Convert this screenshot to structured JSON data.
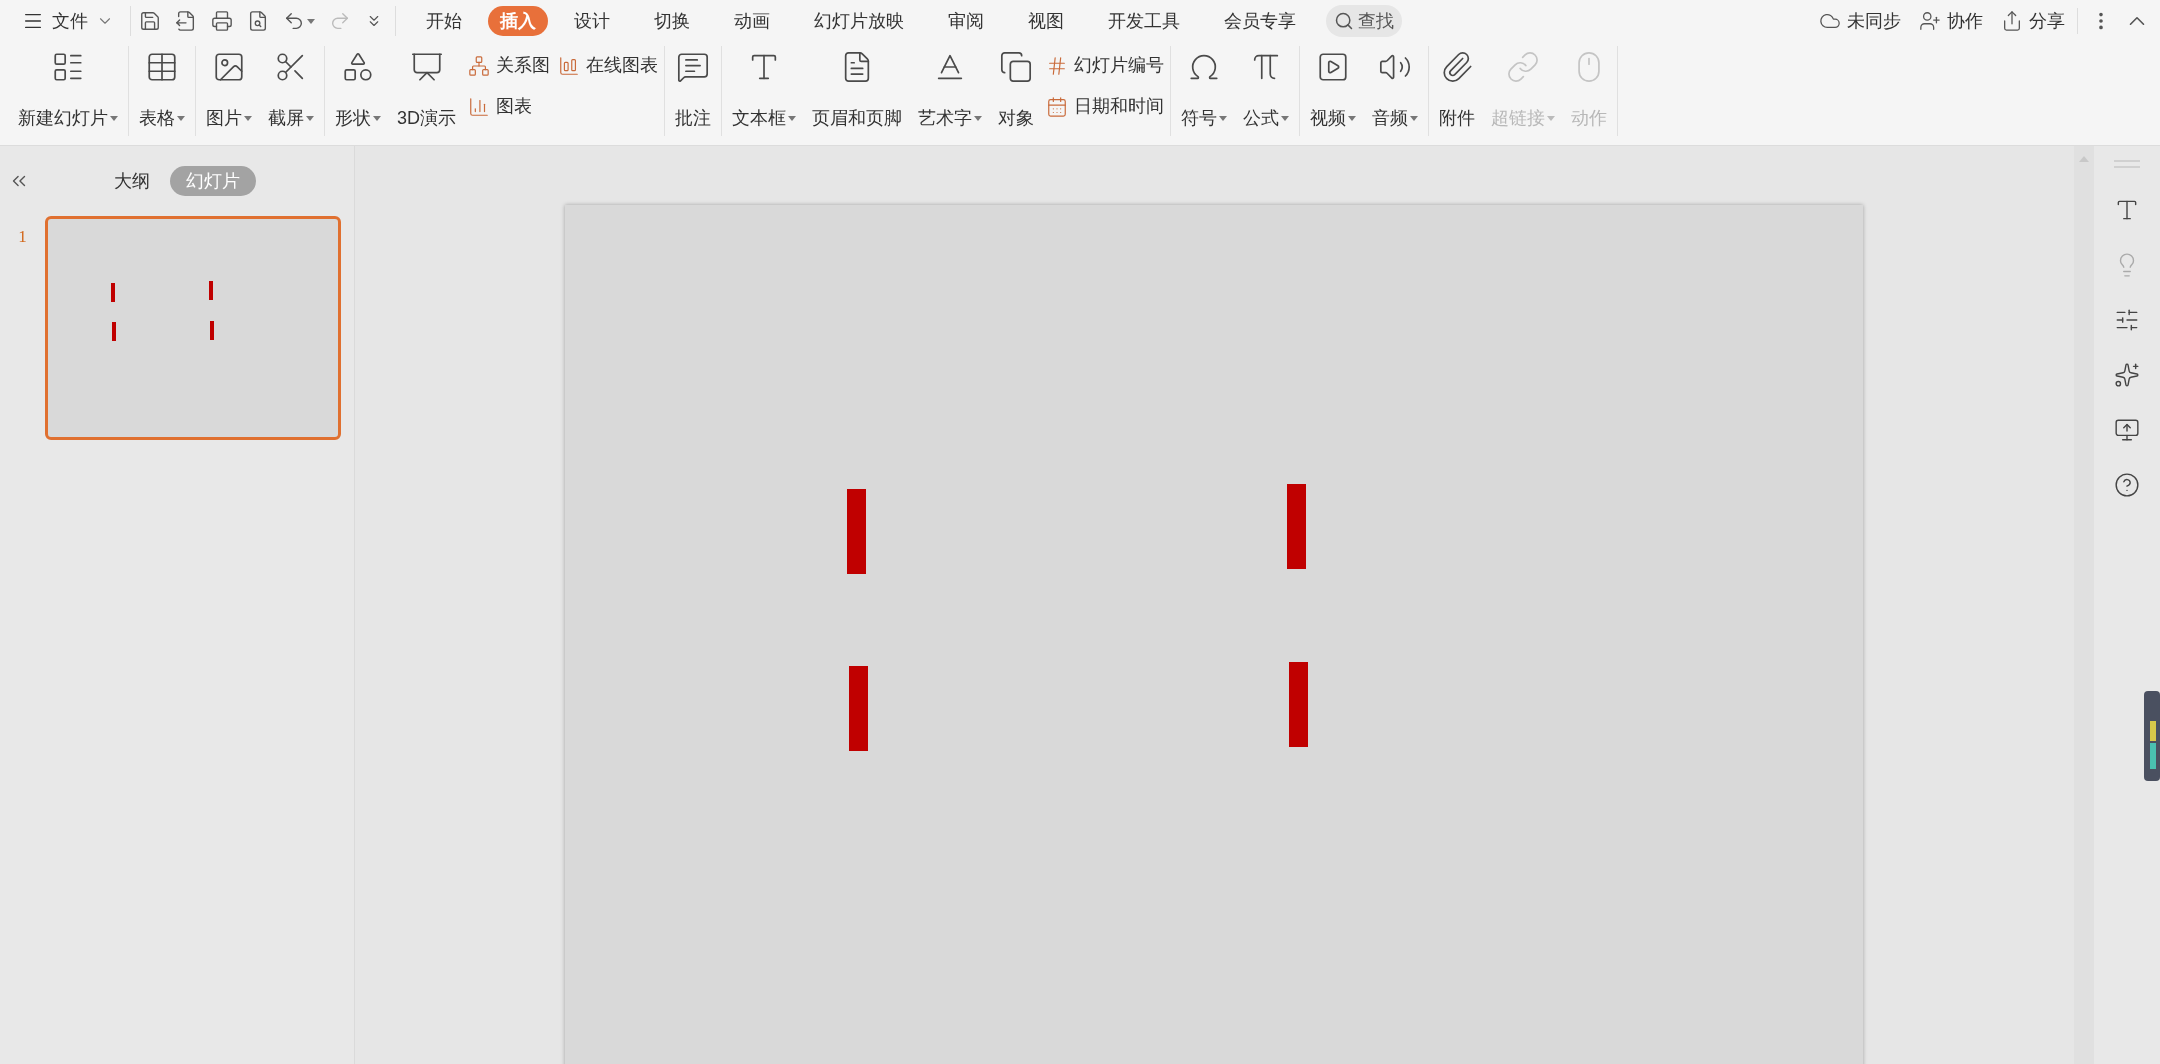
{
  "file_menu": {
    "label": "文件"
  },
  "menu_tabs": [
    {
      "label": "开始",
      "selected": false
    },
    {
      "label": "插入",
      "selected": true
    },
    {
      "label": "设计",
      "selected": false
    },
    {
      "label": "切换",
      "selected": false
    },
    {
      "label": "动画",
      "selected": false
    },
    {
      "label": "幻灯片放映",
      "selected": false
    },
    {
      "label": "审阅",
      "selected": false
    },
    {
      "label": "视图",
      "selected": false
    },
    {
      "label": "开发工具",
      "selected": false
    },
    {
      "label": "会员专享",
      "selected": false
    }
  ],
  "search": {
    "label": "查找"
  },
  "top_actions": [
    {
      "label": "未同步"
    },
    {
      "label": "协作"
    },
    {
      "label": "分享"
    }
  ],
  "ribbon_groups": [
    {
      "items": [
        {
          "kind": "large",
          "label": "新建幻灯片",
          "dropdown": true,
          "disabled": false
        }
      ]
    },
    {
      "items": [
        {
          "kind": "large",
          "label": "表格",
          "dropdown": true,
          "disabled": false
        }
      ]
    },
    {
      "items": [
        {
          "kind": "large",
          "label": "图片",
          "dropdown": true,
          "disabled": false
        },
        {
          "kind": "large",
          "label": "截屏",
          "dropdown": true,
          "disabled": false
        }
      ]
    },
    {
      "items": [
        {
          "kind": "large",
          "label": "形状",
          "dropdown": true,
          "disabled": false
        },
        {
          "kind": "large",
          "label": "3D演示",
          "dropdown": false,
          "disabled": false
        },
        {
          "kind": "stack",
          "entries": [
            {
              "label": "关系图"
            },
            {
              "label": "图表"
            }
          ]
        },
        {
          "kind": "stack",
          "entries": [
            {
              "label": "在线图表"
            }
          ]
        }
      ]
    },
    {
      "items": [
        {
          "kind": "large",
          "label": "批注",
          "dropdown": false,
          "disabled": false
        }
      ]
    },
    {
      "items": [
        {
          "kind": "large",
          "label": "文本框",
          "dropdown": true,
          "disabled": false
        },
        {
          "kind": "large",
          "label": "页眉和页脚",
          "dropdown": false,
          "disabled": false
        },
        {
          "kind": "large",
          "label": "艺术字",
          "dropdown": true,
          "disabled": false
        },
        {
          "kind": "large",
          "label": "对象",
          "dropdown": false,
          "disabled": false
        },
        {
          "kind": "stack",
          "entries": [
            {
              "label": "幻灯片编号"
            },
            {
              "label": "日期和时间"
            }
          ]
        }
      ]
    },
    {
      "items": [
        {
          "kind": "large",
          "label": "符号",
          "dropdown": true,
          "disabled": false
        },
        {
          "kind": "large",
          "label": "公式",
          "dropdown": true,
          "disabled": false
        }
      ]
    },
    {
      "items": [
        {
          "kind": "large",
          "label": "视频",
          "dropdown": true,
          "disabled": false
        },
        {
          "kind": "large",
          "label": "音频",
          "dropdown": true,
          "disabled": false
        }
      ]
    },
    {
      "items": [
        {
          "kind": "large",
          "label": "附件",
          "dropdown": false,
          "disabled": false
        },
        {
          "kind": "large",
          "label": "超链接",
          "dropdown": true,
          "disabled": true
        },
        {
          "kind": "large",
          "label": "动作",
          "dropdown": false,
          "disabled": true
        }
      ]
    }
  ],
  "panel_tabs": [
    {
      "label": "大纲",
      "selected": false
    },
    {
      "label": "幻灯片",
      "selected": true
    }
  ],
  "slides": [
    {
      "number": "1",
      "selected": true
    }
  ]
}
